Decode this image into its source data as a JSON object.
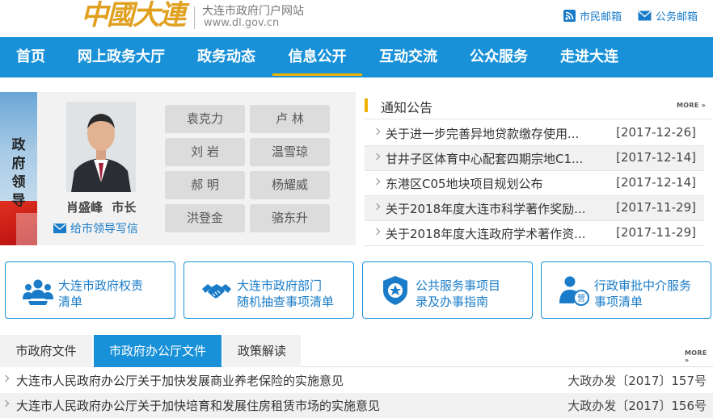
{
  "header": {
    "logo_text": "中國大連",
    "site_name": "大连市政府门户网站",
    "site_url": "www.dl.gov.cn",
    "citizen_mail": "市民邮箱",
    "official_mail": "公务邮箱"
  },
  "nav": {
    "items": [
      "首页",
      "网上政务大厅",
      "政务动态",
      "信息公开",
      "互动交流",
      "公众服务",
      "走进大连"
    ],
    "active": "信息公开"
  },
  "leaders": {
    "banner_title": "政府领导",
    "mayor_name": "肖盛峰",
    "mayor_title": "市长",
    "write_letter": "给市领导写信",
    "names": [
      "袁克力",
      "卢 林",
      "刘 岩",
      "温雪琼",
      "郝 明",
      "杨耀威",
      "洪登金",
      "骆东升"
    ]
  },
  "notices": {
    "title": "通知公告",
    "more": "MORE",
    "items": [
      {
        "text": "关于进一步完善异地贷款缴存使用...",
        "date": "[2017-12-26]"
      },
      {
        "text": "甘井子区体育中心配套四期宗地C1...",
        "date": "[2017-12-14]"
      },
      {
        "text": "东港区C05地块项目规划公布",
        "date": "[2017-12-14]"
      },
      {
        "text": "关于2018年度大连市科学著作奖励...",
        "date": "[2017-11-29]"
      },
      {
        "text": "关于2018年度大连政府学术著作资...",
        "date": "[2017-11-29]"
      }
    ]
  },
  "services": [
    {
      "line1": "大连市政府权责",
      "line2": "清单",
      "icon": "people-group-icon"
    },
    {
      "line1": "大连市政府部门",
      "line2": "随机抽查事项清单",
      "icon": "handshake-icon"
    },
    {
      "line1": "公共服务事项目",
      "line2": "录及办事指南",
      "icon": "police-badge-icon"
    },
    {
      "line1": "行政审批中介服务",
      "line2": "事项清单",
      "icon": "approval-person-icon"
    }
  ],
  "documents": {
    "tabs": [
      "市政府文件",
      "市政府办公厅文件",
      "政策解读"
    ],
    "active_tab": "市政府办公厅文件",
    "more": "MORE",
    "items": [
      {
        "text": "大连市人民政府办公厅关于加快发展商业养老保险的实施意见",
        "number": "大政办发〔2017〕157号"
      },
      {
        "text": "大连市人民政府办公厅关于加快培育和发展住房租赁市场的实施意见",
        "number": "大政办发〔2017〕156号"
      }
    ]
  },
  "colors": {
    "primary_blue": "#1891d8",
    "accent_yellow": "#f0b400",
    "link_blue": "#1a7cc8"
  }
}
